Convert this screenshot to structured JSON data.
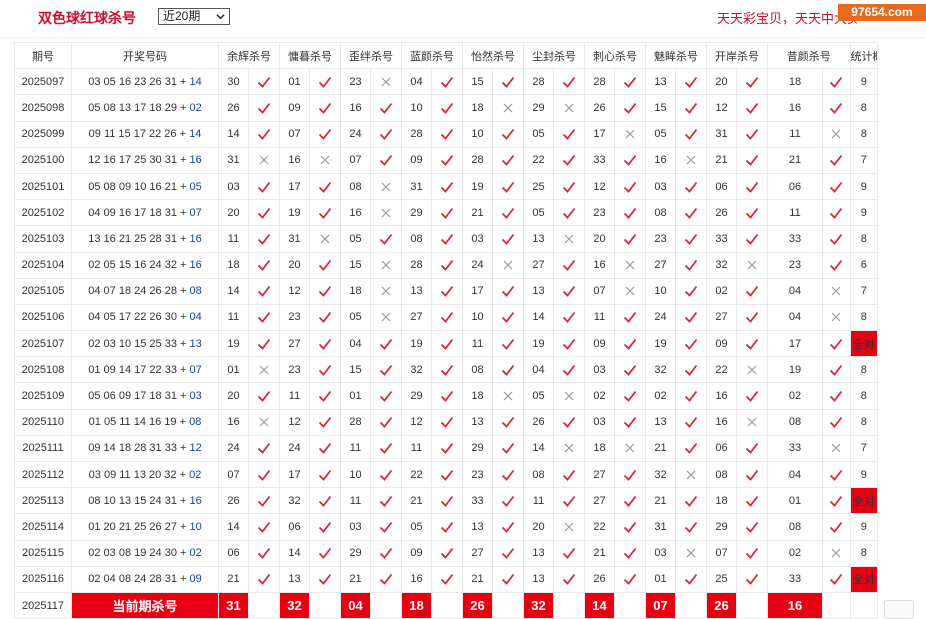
{
  "header": {
    "title": "双色球红球杀号",
    "period_select": "近20期",
    "promo": "天天彩宝贝，天天中大奖",
    "watermark": "97654.com"
  },
  "table": {
    "columns": [
      "期号",
      "开奖号码",
      "余辉杀号",
      "慵暮杀号",
      "歪绊杀号",
      "蓝颜杀号",
      "怡然杀号",
      "尘封杀号",
      "刺心杀号",
      "魅眸杀号",
      "开岸杀号",
      "昔颜杀号",
      "统计概况"
    ],
    "rows": [
      {
        "period": "2025097",
        "red": "03 05 16 23 26 31",
        "blue": "14",
        "kills": [
          {
            "n": "30",
            "ok": true
          },
          {
            "n": "01",
            "ok": true
          },
          {
            "n": "23",
            "ok": false
          },
          {
            "n": "04",
            "ok": true
          },
          {
            "n": "15",
            "ok": true
          },
          {
            "n": "28",
            "ok": true
          },
          {
            "n": "28",
            "ok": true
          },
          {
            "n": "13",
            "ok": true
          },
          {
            "n": "20",
            "ok": true
          },
          {
            "n": "18",
            "ok": true
          }
        ],
        "summary": "9"
      },
      {
        "period": "2025098",
        "red": "05 08 13 17 18 29",
        "blue": "02",
        "kills": [
          {
            "n": "26",
            "ok": true
          },
          {
            "n": "09",
            "ok": true
          },
          {
            "n": "16",
            "ok": true
          },
          {
            "n": "10",
            "ok": true
          },
          {
            "n": "18",
            "ok": false
          },
          {
            "n": "29",
            "ok": false
          },
          {
            "n": "26",
            "ok": true
          },
          {
            "n": "15",
            "ok": true
          },
          {
            "n": "12",
            "ok": true
          },
          {
            "n": "16",
            "ok": true
          }
        ],
        "summary": "8"
      },
      {
        "period": "2025099",
        "red": "09 11 15 17 22 26",
        "blue": "14",
        "kills": [
          {
            "n": "14",
            "ok": true
          },
          {
            "n": "07",
            "ok": true
          },
          {
            "n": "24",
            "ok": true
          },
          {
            "n": "28",
            "ok": true
          },
          {
            "n": "10",
            "ok": true
          },
          {
            "n": "05",
            "ok": true
          },
          {
            "n": "17",
            "ok": false
          },
          {
            "n": "05",
            "ok": true
          },
          {
            "n": "31",
            "ok": true
          },
          {
            "n": "11",
            "ok": false
          }
        ],
        "summary": "8"
      },
      {
        "period": "2025100",
        "red": "12 16 17 25 30 31",
        "blue": "16",
        "kills": [
          {
            "n": "31",
            "ok": false
          },
          {
            "n": "16",
            "ok": false
          },
          {
            "n": "07",
            "ok": true
          },
          {
            "n": "09",
            "ok": true
          },
          {
            "n": "28",
            "ok": true
          },
          {
            "n": "22",
            "ok": true
          },
          {
            "n": "33",
            "ok": true
          },
          {
            "n": "16",
            "ok": false
          },
          {
            "n": "21",
            "ok": true
          },
          {
            "n": "21",
            "ok": true
          }
        ],
        "summary": "7"
      },
      {
        "period": "2025101",
        "red": "05 08 09 10 16 21",
        "blue": "05",
        "kills": [
          {
            "n": "03",
            "ok": true
          },
          {
            "n": "17",
            "ok": true
          },
          {
            "n": "08",
            "ok": false
          },
          {
            "n": "31",
            "ok": true
          },
          {
            "n": "19",
            "ok": true
          },
          {
            "n": "25",
            "ok": true
          },
          {
            "n": "12",
            "ok": true
          },
          {
            "n": "03",
            "ok": true
          },
          {
            "n": "06",
            "ok": true
          },
          {
            "n": "06",
            "ok": true
          }
        ],
        "summary": "9"
      },
      {
        "period": "2025102",
        "red": "04 09 16 17 18 31",
        "blue": "07",
        "kills": [
          {
            "n": "20",
            "ok": true
          },
          {
            "n": "19",
            "ok": true
          },
          {
            "n": "16",
            "ok": false
          },
          {
            "n": "29",
            "ok": true
          },
          {
            "n": "21",
            "ok": true
          },
          {
            "n": "05",
            "ok": true
          },
          {
            "n": "23",
            "ok": true
          },
          {
            "n": "08",
            "ok": true
          },
          {
            "n": "26",
            "ok": true
          },
          {
            "n": "11",
            "ok": true
          }
        ],
        "summary": "9"
      },
      {
        "period": "2025103",
        "red": "13 16 21 25 28 31",
        "blue": "16",
        "kills": [
          {
            "n": "11",
            "ok": true
          },
          {
            "n": "31",
            "ok": false
          },
          {
            "n": "05",
            "ok": true
          },
          {
            "n": "08",
            "ok": true
          },
          {
            "n": "03",
            "ok": true
          },
          {
            "n": "13",
            "ok": false
          },
          {
            "n": "20",
            "ok": true
          },
          {
            "n": "23",
            "ok": true
          },
          {
            "n": "33",
            "ok": true
          },
          {
            "n": "33",
            "ok": true
          }
        ],
        "summary": "8"
      },
      {
        "period": "2025104",
        "red": "02 05 15 16 24 32",
        "blue": "16",
        "kills": [
          {
            "n": "18",
            "ok": true
          },
          {
            "n": "20",
            "ok": true
          },
          {
            "n": "15",
            "ok": false
          },
          {
            "n": "28",
            "ok": true
          },
          {
            "n": "24",
            "ok": false
          },
          {
            "n": "27",
            "ok": true
          },
          {
            "n": "16",
            "ok": false
          },
          {
            "n": "27",
            "ok": true
          },
          {
            "n": "32",
            "ok": false
          },
          {
            "n": "23",
            "ok": true
          }
        ],
        "summary": "6"
      },
      {
        "period": "2025105",
        "red": "04 07 18 24 26 28",
        "blue": "08",
        "kills": [
          {
            "n": "14",
            "ok": true
          },
          {
            "n": "12",
            "ok": true
          },
          {
            "n": "18",
            "ok": false
          },
          {
            "n": "13",
            "ok": true
          },
          {
            "n": "17",
            "ok": true
          },
          {
            "n": "13",
            "ok": true
          },
          {
            "n": "07",
            "ok": false
          },
          {
            "n": "10",
            "ok": true
          },
          {
            "n": "02",
            "ok": true
          },
          {
            "n": "04",
            "ok": false
          }
        ],
        "summary": "7"
      },
      {
        "period": "2025106",
        "red": "04 05 17 22 26 30",
        "blue": "04",
        "kills": [
          {
            "n": "11",
            "ok": true
          },
          {
            "n": "23",
            "ok": true
          },
          {
            "n": "05",
            "ok": false
          },
          {
            "n": "27",
            "ok": true
          },
          {
            "n": "10",
            "ok": true
          },
          {
            "n": "14",
            "ok": true
          },
          {
            "n": "11",
            "ok": true
          },
          {
            "n": "24",
            "ok": true
          },
          {
            "n": "27",
            "ok": true
          },
          {
            "n": "04",
            "ok": false
          }
        ],
        "summary": "8"
      },
      {
        "period": "2025107",
        "red": "02 03 10 15 25 33",
        "blue": "13",
        "kills": [
          {
            "n": "19",
            "ok": true
          },
          {
            "n": "27",
            "ok": true
          },
          {
            "n": "04",
            "ok": true
          },
          {
            "n": "19",
            "ok": true
          },
          {
            "n": "11",
            "ok": true
          },
          {
            "n": "19",
            "ok": true
          },
          {
            "n": "09",
            "ok": true
          },
          {
            "n": "19",
            "ok": true
          },
          {
            "n": "09",
            "ok": true
          },
          {
            "n": "17",
            "ok": true
          }
        ],
        "summary": "全对",
        "all": true
      },
      {
        "period": "2025108",
        "red": "01 09 14 17 22 33",
        "blue": "07",
        "kills": [
          {
            "n": "01",
            "ok": false
          },
          {
            "n": "23",
            "ok": true
          },
          {
            "n": "15",
            "ok": true
          },
          {
            "n": "32",
            "ok": true
          },
          {
            "n": "08",
            "ok": true
          },
          {
            "n": "04",
            "ok": true
          },
          {
            "n": "03",
            "ok": true
          },
          {
            "n": "32",
            "ok": true
          },
          {
            "n": "22",
            "ok": false
          },
          {
            "n": "19",
            "ok": true
          }
        ],
        "summary": "8"
      },
      {
        "period": "2025109",
        "red": "05 06 09 17 18 31",
        "blue": "03",
        "kills": [
          {
            "n": "20",
            "ok": true
          },
          {
            "n": "11",
            "ok": true
          },
          {
            "n": "01",
            "ok": true
          },
          {
            "n": "29",
            "ok": true
          },
          {
            "n": "18",
            "ok": false
          },
          {
            "n": "05",
            "ok": false
          },
          {
            "n": "02",
            "ok": true
          },
          {
            "n": "02",
            "ok": true
          },
          {
            "n": "16",
            "ok": true
          },
          {
            "n": "02",
            "ok": true
          }
        ],
        "summary": "8"
      },
      {
        "period": "2025110",
        "red": "01 05 11 14 16 19",
        "blue": "08",
        "kills": [
          {
            "n": "16",
            "ok": false
          },
          {
            "n": "12",
            "ok": true
          },
          {
            "n": "28",
            "ok": true
          },
          {
            "n": "12",
            "ok": true
          },
          {
            "n": "13",
            "ok": true
          },
          {
            "n": "26",
            "ok": true
          },
          {
            "n": "03",
            "ok": true
          },
          {
            "n": "13",
            "ok": true
          },
          {
            "n": "16",
            "ok": false
          },
          {
            "n": "08",
            "ok": true
          }
        ],
        "summary": "8"
      },
      {
        "period": "2025111",
        "red": "09 14 18 28 31 33",
        "blue": "12",
        "kills": [
          {
            "n": "24",
            "ok": true
          },
          {
            "n": "24",
            "ok": true
          },
          {
            "n": "11",
            "ok": true
          },
          {
            "n": "11",
            "ok": true
          },
          {
            "n": "29",
            "ok": true
          },
          {
            "n": "14",
            "ok": false
          },
          {
            "n": "18",
            "ok": false
          },
          {
            "n": "21",
            "ok": true
          },
          {
            "n": "06",
            "ok": true
          },
          {
            "n": "33",
            "ok": false
          }
        ],
        "summary": "7"
      },
      {
        "period": "2025112",
        "red": "03 09 11 13 20 32",
        "blue": "02",
        "kills": [
          {
            "n": "07",
            "ok": true
          },
          {
            "n": "17",
            "ok": true
          },
          {
            "n": "10",
            "ok": true
          },
          {
            "n": "22",
            "ok": true
          },
          {
            "n": "23",
            "ok": true
          },
          {
            "n": "08",
            "ok": true
          },
          {
            "n": "27",
            "ok": true
          },
          {
            "n": "32",
            "ok": false
          },
          {
            "n": "08",
            "ok": true
          },
          {
            "n": "04",
            "ok": true
          }
        ],
        "summary": "9"
      },
      {
        "period": "2025113",
        "red": "08 10 13 15 24 31",
        "blue": "16",
        "kills": [
          {
            "n": "26",
            "ok": true
          },
          {
            "n": "32",
            "ok": true
          },
          {
            "n": "11",
            "ok": true
          },
          {
            "n": "21",
            "ok": true
          },
          {
            "n": "33",
            "ok": true
          },
          {
            "n": "11",
            "ok": true
          },
          {
            "n": "27",
            "ok": true
          },
          {
            "n": "21",
            "ok": true
          },
          {
            "n": "18",
            "ok": true
          },
          {
            "n": "01",
            "ok": true
          }
        ],
        "summary": "全对",
        "all": true
      },
      {
        "period": "2025114",
        "red": "01 20 21 25 26 27",
        "blue": "10",
        "kills": [
          {
            "n": "14",
            "ok": true
          },
          {
            "n": "06",
            "ok": true
          },
          {
            "n": "03",
            "ok": true
          },
          {
            "n": "05",
            "ok": true
          },
          {
            "n": "13",
            "ok": true
          },
          {
            "n": "20",
            "ok": false
          },
          {
            "n": "22",
            "ok": true
          },
          {
            "n": "31",
            "ok": true
          },
          {
            "n": "29",
            "ok": true
          },
          {
            "n": "08",
            "ok": true
          }
        ],
        "summary": "9"
      },
      {
        "period": "2025115",
        "red": "02 03 08 19 24 30",
        "blue": "02",
        "kills": [
          {
            "n": "06",
            "ok": true
          },
          {
            "n": "14",
            "ok": true
          },
          {
            "n": "29",
            "ok": true
          },
          {
            "n": "09",
            "ok": true
          },
          {
            "n": "27",
            "ok": true
          },
          {
            "n": "13",
            "ok": true
          },
          {
            "n": "21",
            "ok": true
          },
          {
            "n": "03",
            "ok": false
          },
          {
            "n": "07",
            "ok": true
          },
          {
            "n": "02",
            "ok": false
          }
        ],
        "summary": "8"
      },
      {
        "period": "2025116",
        "red": "02 04 08 24 28 31",
        "blue": "09",
        "kills": [
          {
            "n": "21",
            "ok": true
          },
          {
            "n": "13",
            "ok": true
          },
          {
            "n": "21",
            "ok": true
          },
          {
            "n": "16",
            "ok": true
          },
          {
            "n": "21",
            "ok": true
          },
          {
            "n": "13",
            "ok": true
          },
          {
            "n": "26",
            "ok": true
          },
          {
            "n": "01",
            "ok": true
          },
          {
            "n": "25",
            "ok": true
          },
          {
            "n": "33",
            "ok": true
          }
        ],
        "summary": "全对",
        "all": true
      }
    ],
    "current": {
      "period": "2025117",
      "label": "当前期杀号",
      "kills": [
        "31",
        "32",
        "04",
        "18",
        "26",
        "32",
        "14",
        "07",
        "26",
        "16"
      ]
    }
  }
}
